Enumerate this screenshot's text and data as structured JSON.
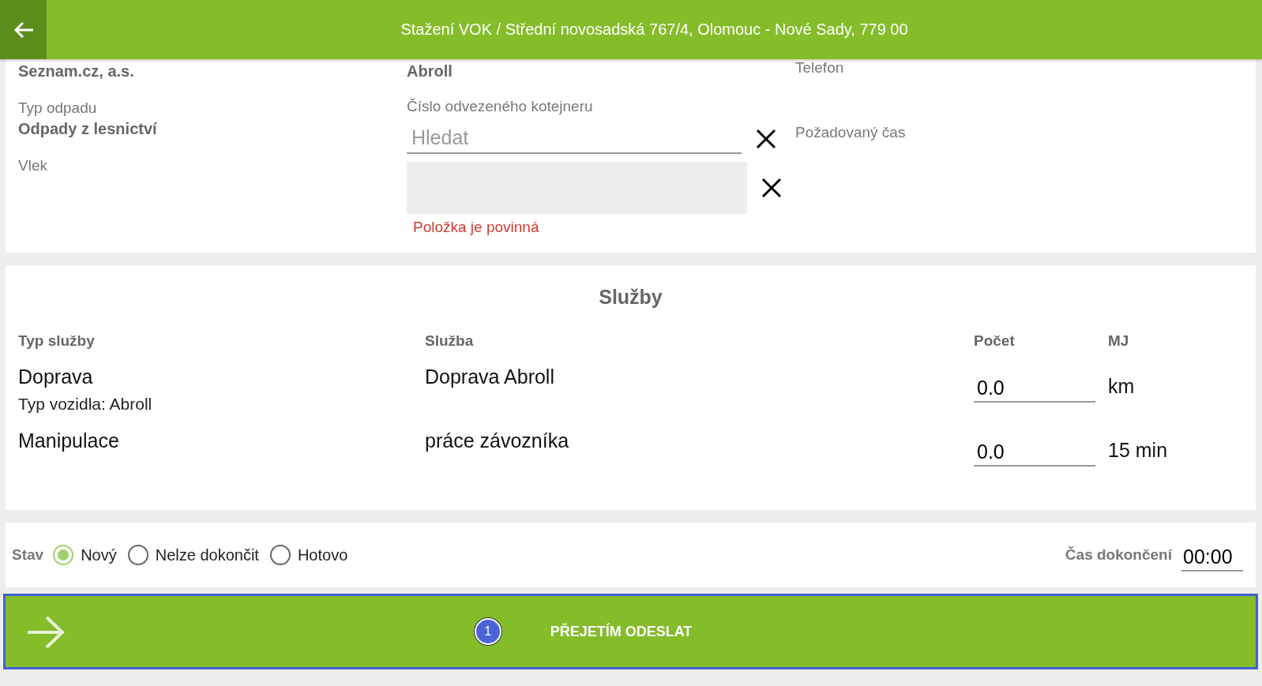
{
  "header": {
    "title": "Stažení VOK / Střední novosadská 767/4, Olomouc - Nové Sady, 779 00"
  },
  "details": {
    "customer": "Seznam.cz, a.s.",
    "waste_type_label": "Typ odpadu",
    "waste_type": "Odpady z lesnictví",
    "trailer_label": "Vlek",
    "vehicle": "Abroll",
    "container_label": "Číslo odvezeného kotejneru",
    "search": {
      "placeholder": "Hledat"
    },
    "required_error": "Položka je povinná",
    "phone_label": "Telefon",
    "time_label": "Požadovaný čas"
  },
  "services": {
    "title": "Služby",
    "columns": [
      "Typ služby",
      "Služba",
      "Počet",
      "MJ"
    ],
    "rows": [
      {
        "type": "Doprava",
        "subtitle": "Typ vozidla: Abroll",
        "service": "Doprava Abroll",
        "count": "0.0",
        "unit": "km"
      },
      {
        "type": "Manipulace",
        "service": "práce závozníka",
        "count": "0.0",
        "unit": "15 min"
      }
    ]
  },
  "status": {
    "label": "Stav",
    "options": [
      {
        "label": "Nový",
        "selected": true
      },
      {
        "label": "Nelze dokončit",
        "selected": false
      },
      {
        "label": "Hotovo",
        "selected": false
      }
    ],
    "completion_label": "Čas dokončení",
    "completion_time": "00:00"
  },
  "submit": {
    "badge": "1",
    "label": "PŘEJETÍM ODESLAT"
  }
}
